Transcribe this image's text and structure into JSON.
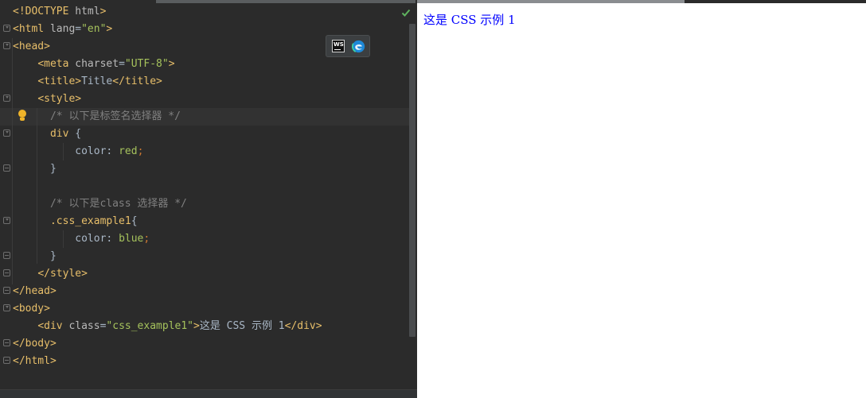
{
  "editor": {
    "lines": [
      [
        [
          "tag",
          "<!DOCTYPE "
        ],
        [
          "attr",
          "html"
        ],
        [
          "tag",
          ">"
        ]
      ],
      [
        [
          "tag",
          "<html "
        ],
        [
          "attr",
          "lang"
        ],
        [
          "txt",
          "="
        ],
        [
          "str",
          "\"en\""
        ],
        [
          "tag",
          ">"
        ]
      ],
      [
        [
          "tag",
          "<head>"
        ]
      ],
      [
        [
          "txt",
          "    "
        ],
        [
          "tag",
          "<meta "
        ],
        [
          "attr",
          "charset"
        ],
        [
          "txt",
          "="
        ],
        [
          "str",
          "\"UTF-8\""
        ],
        [
          "tag",
          ">"
        ]
      ],
      [
        [
          "txt",
          "    "
        ],
        [
          "tag",
          "<title>"
        ],
        [
          "txt",
          "Title"
        ],
        [
          "tag",
          "</title>"
        ]
      ],
      [
        [
          "txt",
          "    "
        ],
        [
          "tag",
          "<style>"
        ]
      ],
      [
        [
          "txt",
          "      "
        ],
        [
          "cmt",
          "/* 以下是标签名选择器 */"
        ]
      ],
      [
        [
          "txt",
          "      "
        ],
        [
          "sel",
          "div "
        ],
        [
          "txt",
          "{"
        ]
      ],
      [
        [
          "txt",
          "          "
        ],
        [
          "txt",
          "color"
        ],
        [
          "txt",
          ": "
        ],
        [
          "val",
          "red"
        ],
        [
          "punct",
          ";"
        ]
      ],
      [
        [
          "txt",
          "      "
        ],
        [
          "txt",
          "}"
        ]
      ],
      [
        [
          "txt",
          ""
        ]
      ],
      [
        [
          "txt",
          "      "
        ],
        [
          "cmt",
          "/* 以下是class 选择器 */"
        ]
      ],
      [
        [
          "txt",
          "      "
        ],
        [
          "sel",
          ".css_example1"
        ],
        [
          "txt",
          "{"
        ]
      ],
      [
        [
          "txt",
          "          "
        ],
        [
          "txt",
          "color"
        ],
        [
          "txt",
          ": "
        ],
        [
          "val",
          "blue"
        ],
        [
          "punct",
          ";"
        ]
      ],
      [
        [
          "txt",
          "      "
        ],
        [
          "txt",
          "}"
        ]
      ],
      [
        [
          "txt",
          "    "
        ],
        [
          "tag",
          "</style>"
        ]
      ],
      [
        [
          "tag",
          "</head>"
        ]
      ],
      [
        [
          "tag",
          "<body>"
        ]
      ],
      [
        [
          "txt",
          "    "
        ],
        [
          "tag",
          "<div "
        ],
        [
          "attr",
          "class"
        ],
        [
          "txt",
          "="
        ],
        [
          "str",
          "\"css_example1\""
        ],
        [
          "tag",
          ">"
        ],
        [
          "txt",
          "这是 CSS 示例 1"
        ],
        [
          "tag",
          "</div>"
        ]
      ],
      [
        [
          "tag",
          "</body>"
        ]
      ],
      [
        [
          "tag",
          "</html>"
        ]
      ]
    ],
    "icons": {
      "inspection_status": "check-icon",
      "intention_action": "lightbulb-icon",
      "browser_webstorm": "webstorm-icon",
      "browser_edge": "edge-icon"
    },
    "ws_label": "WS"
  },
  "preview": {
    "text": "这是 CSS 示例 1",
    "text_color": "#0000ff"
  }
}
